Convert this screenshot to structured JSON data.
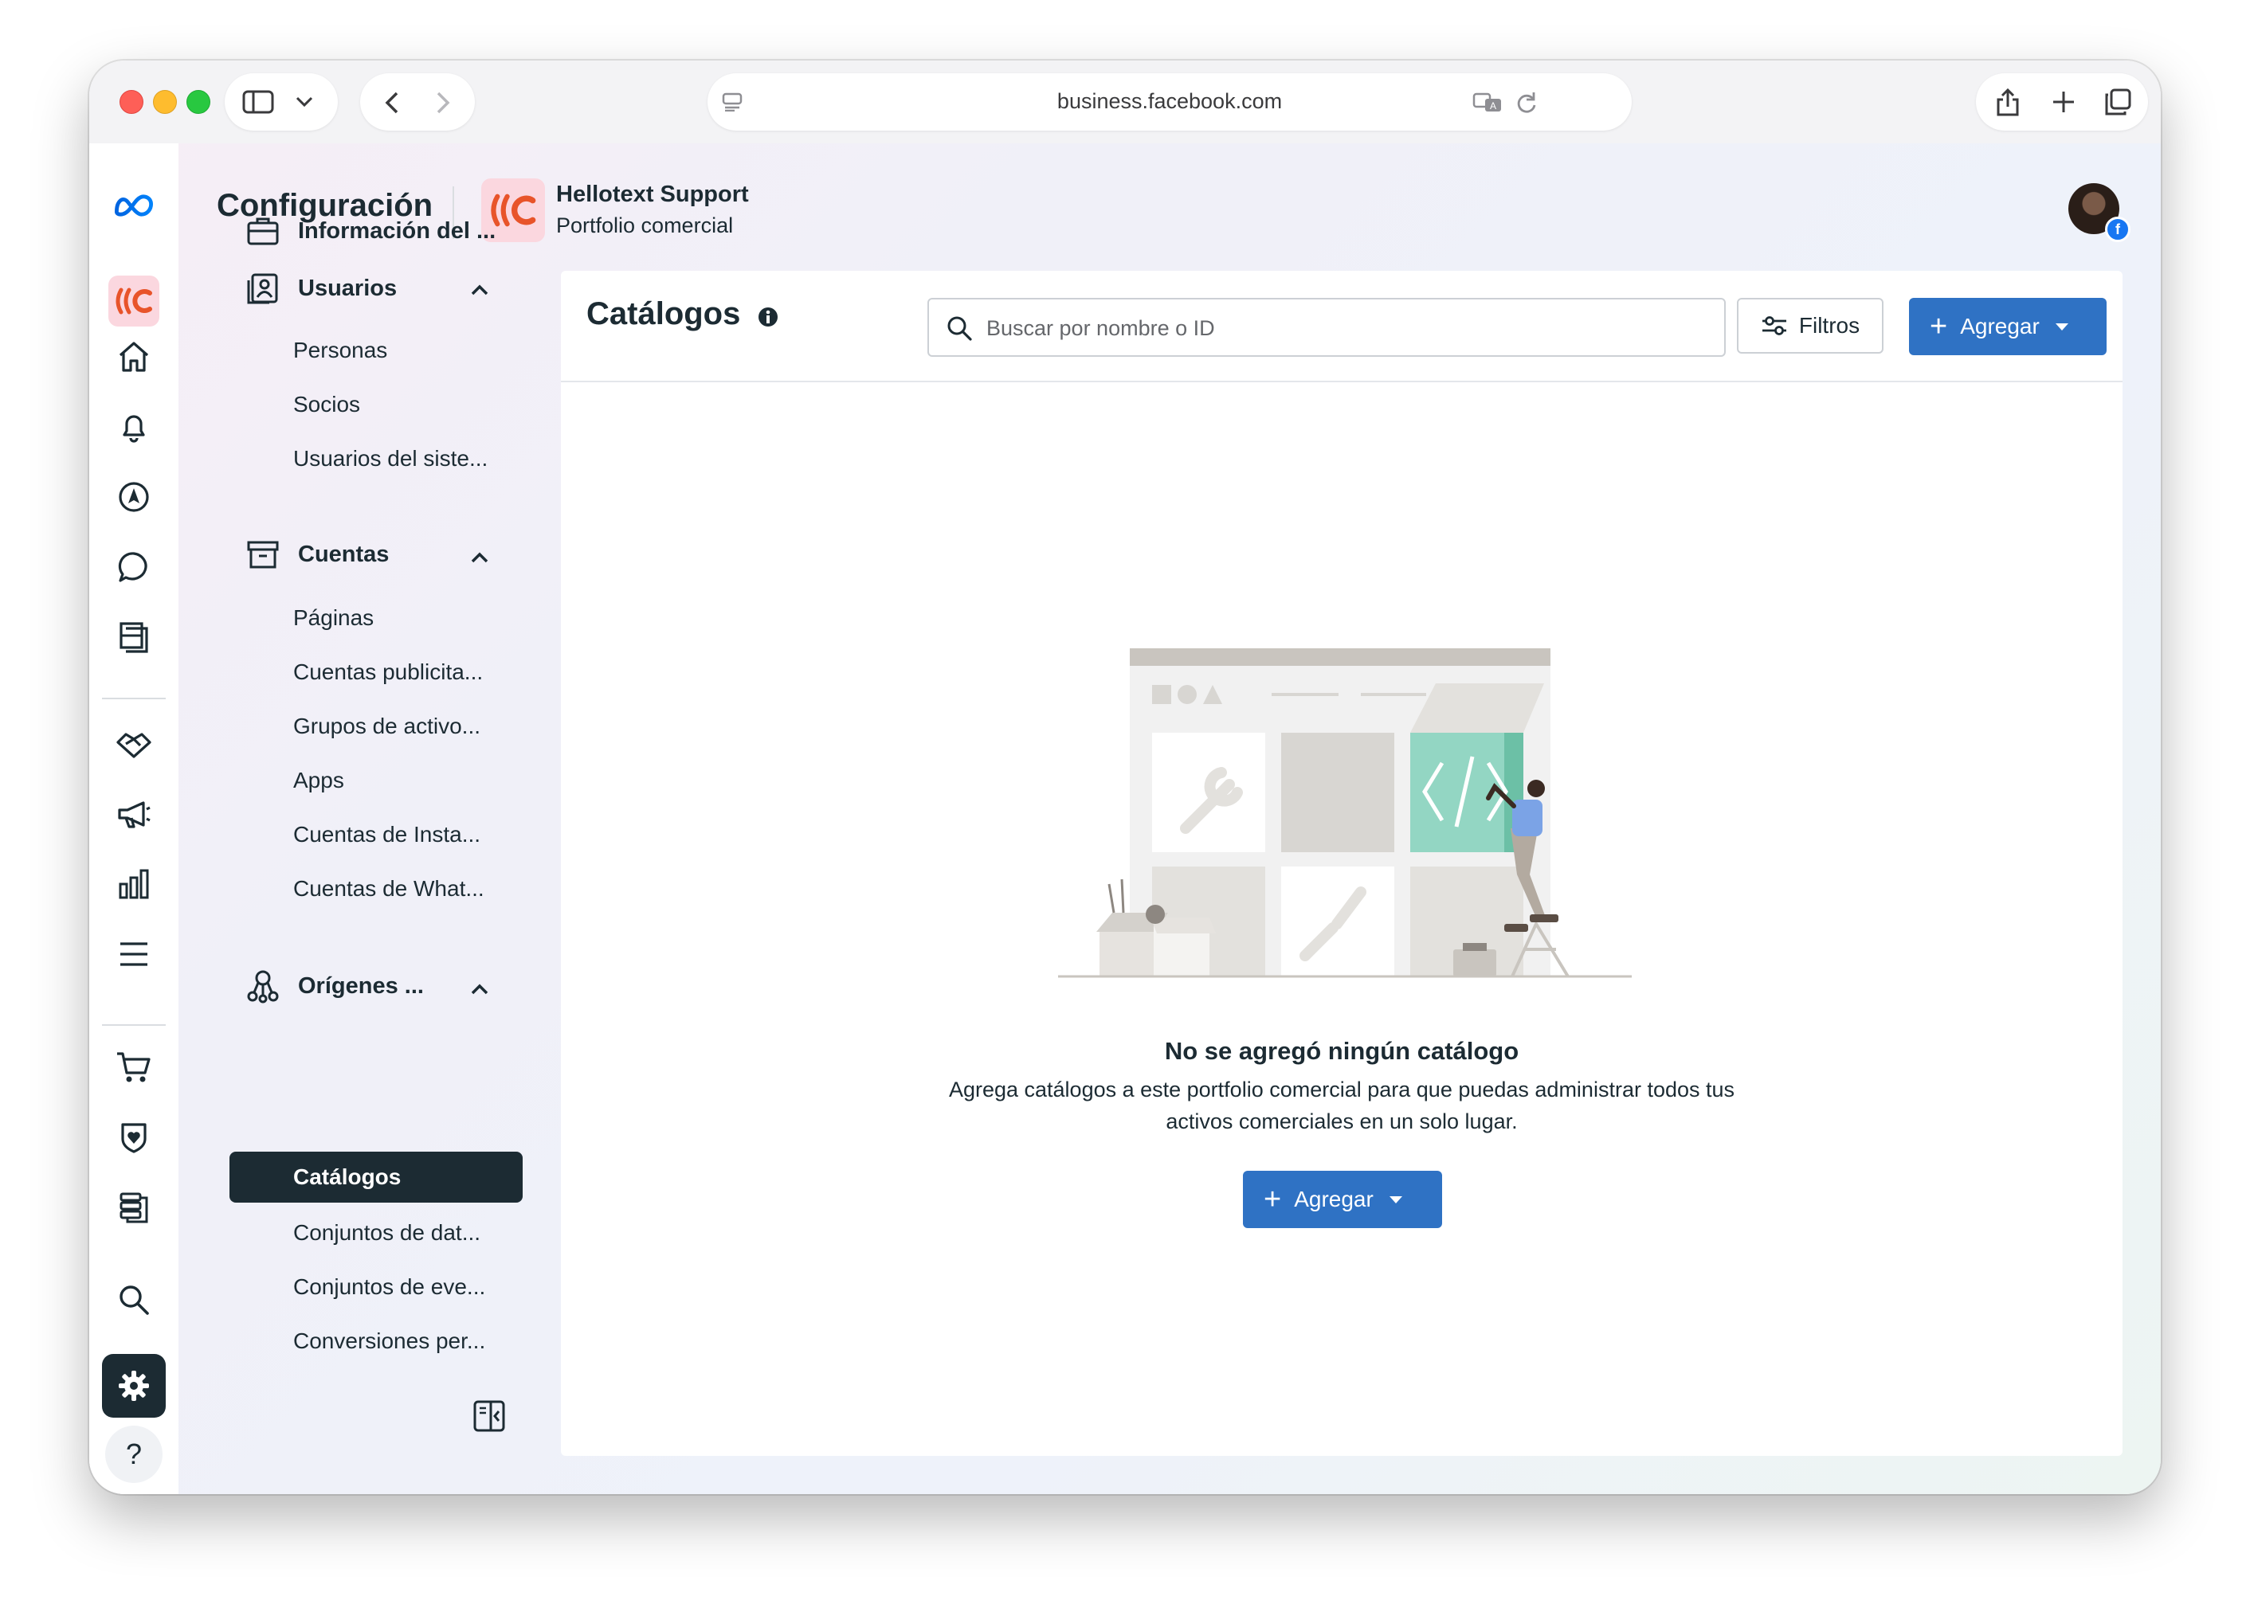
{
  "browser": {
    "url": "business.facebook.com"
  },
  "header": {
    "title": "Configuración",
    "business_name": "Hellotext Support",
    "business_subtitle": "Portfolio comercial"
  },
  "rail": {
    "icons": [
      "meta-logo-icon",
      "business-logo-icon",
      "home-icon",
      "bell-icon",
      "compass-icon",
      "chat-icon",
      "pages-icon",
      "handshake-icon",
      "megaphone-icon",
      "bar-chart-icon",
      "menu-icon",
      "cart-icon",
      "shield-icon",
      "database-icon",
      "search-icon",
      "gear-icon",
      "help-icon"
    ],
    "help_label": "?"
  },
  "sidebar": {
    "business_info": "Información del ...",
    "users": {
      "label": "Usuarios",
      "items": [
        "Personas",
        "Socios",
        "Usuarios del siste..."
      ]
    },
    "accounts": {
      "label": "Cuentas",
      "items": [
        "Páginas",
        "Cuentas publicita...",
        "Grupos de activo...",
        "Apps",
        "Cuentas de Insta...",
        "Cuentas de What..."
      ]
    },
    "data_sources": {
      "label": "Orígenes ...",
      "active_item": "Catálogos",
      "items": [
        "Conjuntos de dat...",
        "Conjuntos de eve...",
        "Conversiones per..."
      ]
    }
  },
  "main": {
    "title": "Catálogos",
    "search_placeholder": "Buscar por nombre o ID",
    "filter_label": "Filtros",
    "add_label": "Agregar",
    "empty_title": "No se agregó ningún catálogo",
    "empty_description": "Agrega catálogos a este portfolio comercial para que puedas administrar todos tus activos comerciales en un solo lugar.",
    "empty_add_label": "Agregar"
  },
  "colors": {
    "primary": "#2f72c4",
    "active_nav": "#1c2b33",
    "brand_bg": "#fbd7df",
    "brand_accent": "#e8542a"
  }
}
